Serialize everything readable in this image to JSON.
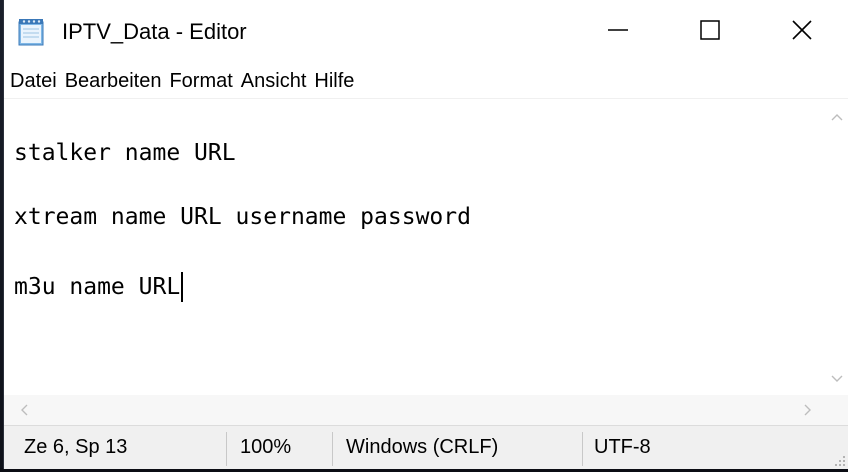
{
  "window": {
    "title": "IPTV_Data - Editor"
  },
  "menu": {
    "items": [
      "Datei",
      "Bearbeiten",
      "Format",
      "Ansicht",
      "Hilfe"
    ]
  },
  "editor": {
    "lines": [
      "stalker name URL",
      "xtream name URL username password",
      "m3u name URL"
    ]
  },
  "statusbar": {
    "position": "Ze 6, Sp 13",
    "zoom": "100%",
    "line_ending": "Windows (CRLF)",
    "encoding": "UTF-8"
  },
  "icons": {
    "app": "notepad-icon",
    "minimize": "minimize-icon",
    "maximize": "maximize-icon",
    "close": "close-icon"
  },
  "colors": {
    "background": "#ffffff",
    "statusbar": "#f0f0f0",
    "desktop": "#0e1119"
  }
}
